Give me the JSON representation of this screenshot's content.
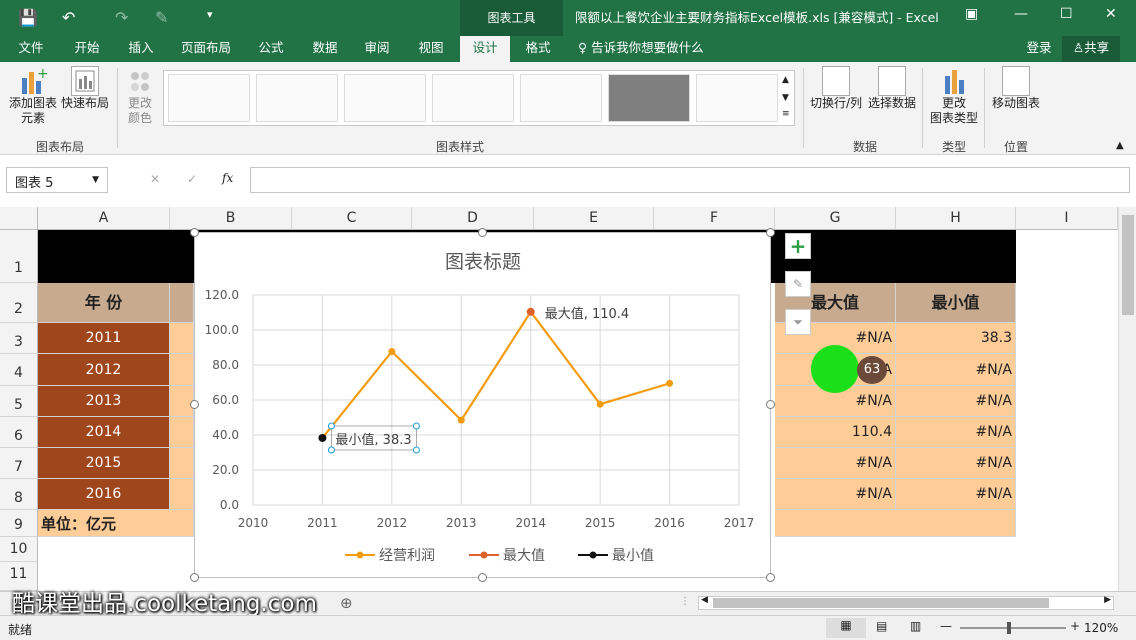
{
  "titlebar": {
    "tool_tab": "图表工具",
    "title": "限额以上餐饮企业主要财务指标Excel模板.xls  [兼容模式] - Excel"
  },
  "menu": {
    "items": [
      "文件",
      "开始",
      "插入",
      "页面布局",
      "公式",
      "数据",
      "审阅",
      "视图",
      "设计",
      "格式"
    ],
    "tell_me": "告诉我你想要做什么",
    "signin": "登录",
    "share": "共享"
  },
  "ribbon": {
    "add_element": "添加图表\n元素",
    "add_element_1": "添加图表",
    "add_element_2": "元素",
    "quick_layout": "快速布局",
    "change_color_1": "更改",
    "change_color_2": "颜色",
    "group_layout": "图表布局",
    "group_styles": "图表样式",
    "switch_row_col": "切换行/列",
    "select_data": "选择数据",
    "group_data": "数据",
    "change_type_1": "更改",
    "change_type_2": "图表类型",
    "group_type": "类型",
    "move_chart": "移动图表",
    "group_location": "位置"
  },
  "formula_bar": {
    "name_box": "图表 5",
    "fx": "fx",
    "cancel": "✕",
    "confirm": "✓"
  },
  "columns": [
    "A",
    "B",
    "C",
    "D",
    "E",
    "F",
    "G",
    "H",
    "I"
  ],
  "rows": [
    "1",
    "2",
    "3",
    "4",
    "5",
    "6",
    "7",
    "8",
    "9",
    "10",
    "11"
  ],
  "table": {
    "header_year": "年    份",
    "header_max": "最大值",
    "header_min": "最小值",
    "years": [
      "2011",
      "2012",
      "2013",
      "2014",
      "2015",
      "2016"
    ],
    "max_col": [
      "#N/A",
      "#N/A",
      "#N/A",
      "110.4",
      "#N/A",
      "#N/A"
    ],
    "min_col": [
      "38.3",
      "#N/A",
      "#N/A",
      "#N/A",
      "#N/A",
      "#N/A"
    ],
    "unit": "单位：亿元"
  },
  "cursor_badge": "63",
  "chart_data": {
    "type": "line",
    "title": "图表标题",
    "x": [
      2011,
      2012,
      2013,
      2014,
      2015,
      2016
    ],
    "xlim": [
      2010,
      2017
    ],
    "ylim": [
      0,
      120
    ],
    "yticks": [
      "0.0",
      "20.0",
      "40.0",
      "60.0",
      "80.0",
      "100.0",
      "120.0"
    ],
    "xticks": [
      "2010",
      "2011",
      "2012",
      "2013",
      "2014",
      "2015",
      "2016",
      "2017"
    ],
    "series": [
      {
        "name": "经营利润",
        "values": [
          38.3,
          87.7,
          48.5,
          110.4,
          57.6,
          69.5
        ],
        "color": "#f39c12"
      },
      {
        "name": "最大值",
        "values": [
          null,
          null,
          null,
          110.4,
          null,
          null
        ],
        "color": "#e0622a"
      },
      {
        "name": "最小值",
        "values": [
          38.3,
          null,
          null,
          null,
          null,
          null
        ],
        "color": "#111111"
      }
    ],
    "labels": {
      "max": "最大值, 110.4",
      "min": "最小值, 38.3"
    },
    "legend": "bottom",
    "grid": true
  },
  "sheet_tabs": {
    "add": "⊕"
  },
  "watermark": "酷课堂出品.coolketang.com",
  "status": {
    "ready": "就绪",
    "zoom": "120%"
  }
}
